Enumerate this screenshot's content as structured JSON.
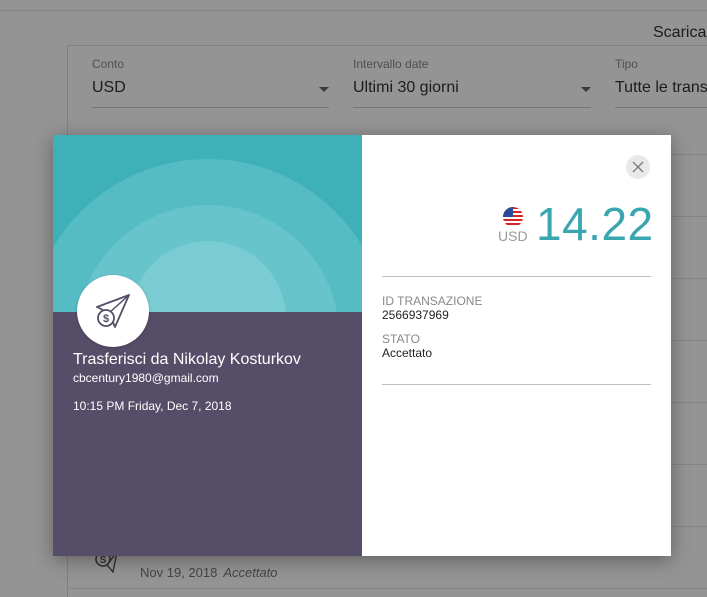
{
  "header": {
    "download_label": "Scarica"
  },
  "filters": [
    {
      "label": "Conto",
      "value": "USD"
    },
    {
      "label": "Intervallo date",
      "value": "Ultimi 30 giorni"
    },
    {
      "label": "Tipo",
      "value": "Tutte le trans"
    }
  ],
  "background_row": {
    "date": "Nov 19, 2018",
    "status": "Accettato"
  },
  "modal": {
    "sender_title": "Trasferisci da Nikolay Kosturkov",
    "sender_email": "cbcentury1980@gmail.com",
    "datetime": "10:15 PM Friday, Dec 7, 2018",
    "currency": "USD",
    "amount": "14.22",
    "transaction_id_label": "ID TRANSAZIONE",
    "transaction_id": "2566937969",
    "status_label": "STATO",
    "status": "Accettato",
    "icons": {
      "close": "close-icon",
      "avatar": "send-money-icon",
      "flag": "us-flag-icon"
    }
  },
  "colors": {
    "accent": "#3aa6b0",
    "hero": "#3eb0b8",
    "left_panel": "#564e68"
  }
}
